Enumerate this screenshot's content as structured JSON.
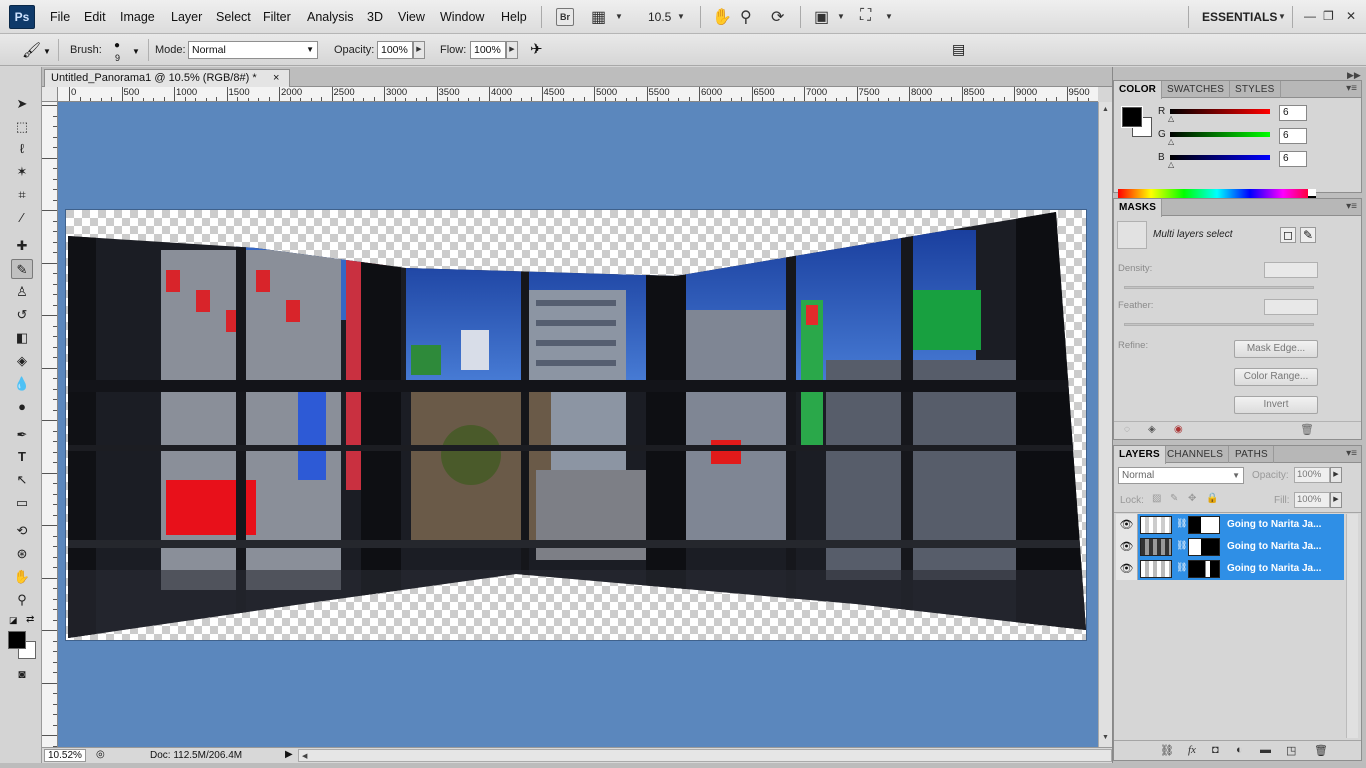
{
  "app": {
    "logo": "Ps"
  },
  "menu": [
    "File",
    "Edit",
    "Image",
    "Layer",
    "Select",
    "Filter",
    "Analysis",
    "3D",
    "View",
    "Window",
    "Help"
  ],
  "menubar": {
    "bridge_icon": "Br",
    "zoom_value": "10.5",
    "workspace": "ESSENTIALS",
    "win_min": "—",
    "win_restore": "❐",
    "win_close": "✕"
  },
  "options": {
    "brush_label": "Brush:",
    "brush_size": "9",
    "mode_label": "Mode:",
    "mode_value": "Normal",
    "opacity_label": "Opacity:",
    "opacity_value": "100%",
    "flow_label": "Flow:",
    "flow_value": "100%"
  },
  "document": {
    "tab_title": "Untitled_Panorama1 @ 10.5% (RGB/8#) *",
    "tab_close": "×",
    "ruler_labels": [
      "0",
      "500",
      "1000",
      "1500",
      "2000",
      "2500",
      "3000",
      "3500",
      "4000",
      "4500",
      "5000",
      "5500",
      "6000",
      "6500",
      "7000",
      "7500",
      "8000",
      "8500",
      "9000",
      "9500"
    ],
    "vruler_labels": [
      "0",
      "500",
      "1000",
      "1500",
      "2000",
      "2500",
      "3000",
      "3500",
      "4000",
      "4500",
      "5000",
      "5500",
      "6000"
    ]
  },
  "status": {
    "zoom": "10.52%",
    "doc_size": "Doc: 112.5M/206.4M"
  },
  "color_panel": {
    "tabs": [
      "COLOR",
      "SWATCHES",
      "STYLES"
    ],
    "channels": [
      {
        "label": "R",
        "value": "6",
        "color": "#cc0000"
      },
      {
        "label": "G",
        "value": "6",
        "color": "#00cc00"
      },
      {
        "label": "B",
        "value": "6",
        "color": "#0000cc"
      }
    ]
  },
  "masks_panel": {
    "tab": "MASKS",
    "selection_text": "Multi layers select",
    "density_label": "Density:",
    "feather_label": "Feather:",
    "refine_label": "Refine:",
    "mask_edge_button": "Mask Edge...",
    "color_range_button": "Color Range...",
    "invert_button": "Invert"
  },
  "layers_panel": {
    "tabs": [
      "LAYERS",
      "CHANNELS",
      "PATHS"
    ],
    "blend_mode": "Normal",
    "opacity_label": "Opacity:",
    "opacity_value": "100%",
    "lock_label": "Lock:",
    "fill_label": "Fill:",
    "fill_value": "100%",
    "layers": [
      {
        "name": "Going to Narita Ja..."
      },
      {
        "name": "Going to Narita Ja..."
      },
      {
        "name": "Going to Narita Ja..."
      }
    ]
  },
  "colors": {
    "canvas_bg": "#5b87bd",
    "selected_layer": "#2f8fe6"
  }
}
